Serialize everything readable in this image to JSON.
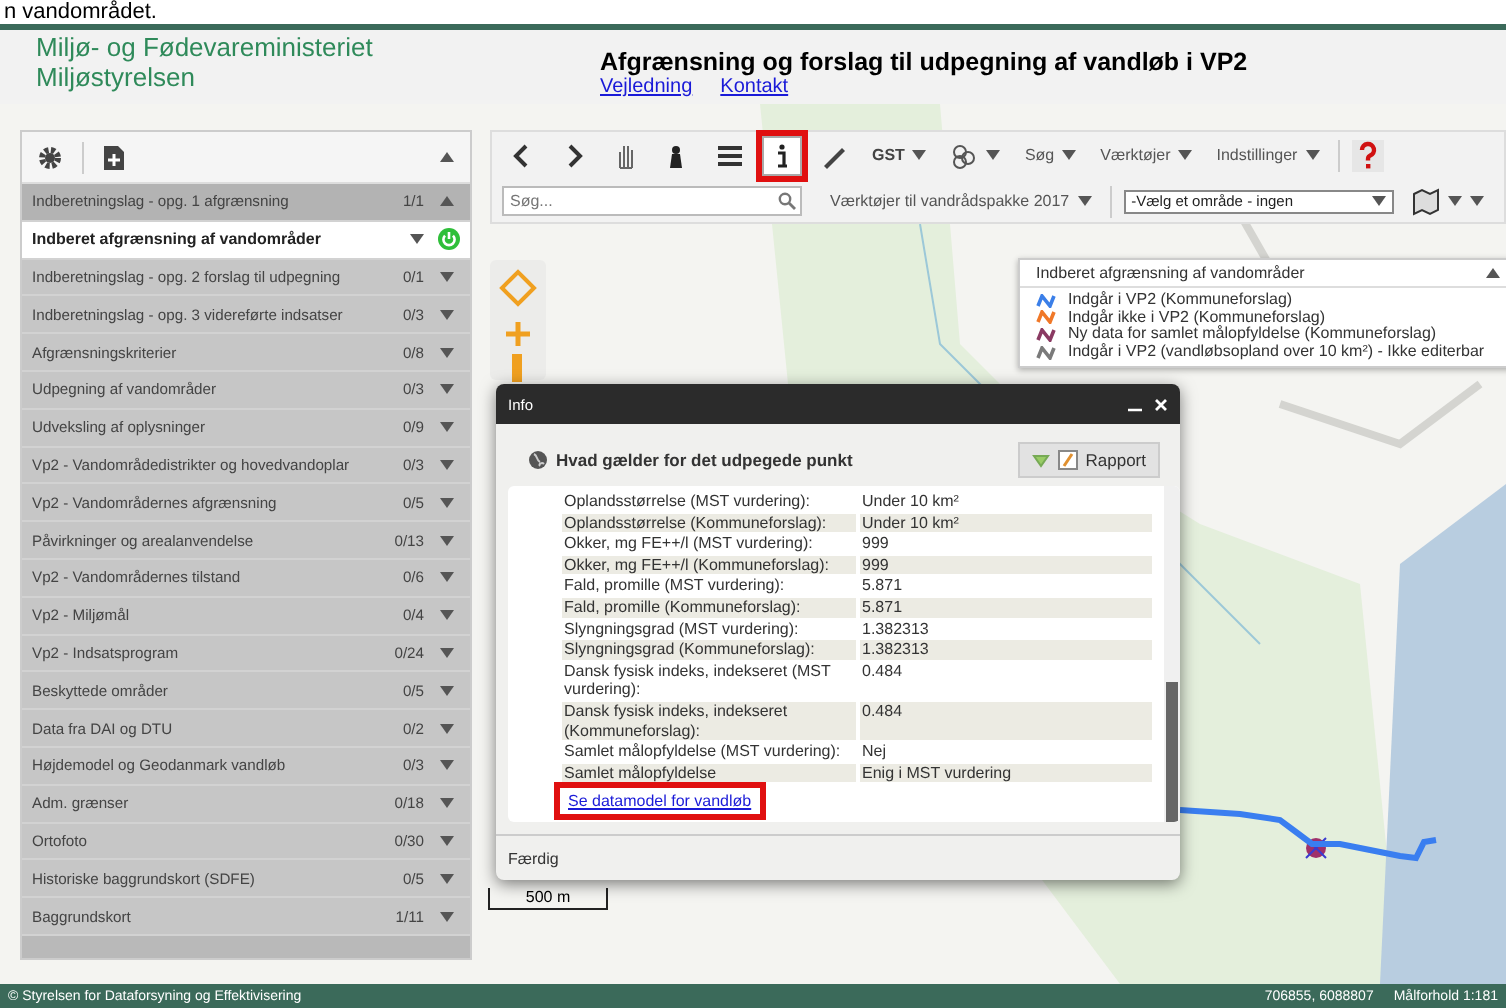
{
  "caption_fragment": "n vandområdet.",
  "header": {
    "ministry": "Miljø- og Fødevareministeriet",
    "agency": "Miljøstyrelsen",
    "title": "Afgrænsning og forslag til udpegning af vandløb i VP2",
    "links": [
      "Vejledning",
      "Kontakt"
    ]
  },
  "layer_panel": {
    "items": [
      {
        "kind": "group",
        "label": "Indberetningslag - opg. 1 afgrænsning",
        "count": "1/1",
        "expanded": true
      },
      {
        "kind": "layer",
        "label": "Indberet afgrænsning af vandområder",
        "visible": true
      },
      {
        "kind": "group",
        "label": "Indberetningslag - opg. 2 forslag til udpegning",
        "count": "0/1",
        "expanded": false
      },
      {
        "kind": "group",
        "label": "Indberetningslag - opg. 3 videreførte indsatser",
        "count": "0/3",
        "expanded": false
      },
      {
        "kind": "group",
        "label": "Afgrænsningskriterier",
        "count": "0/8",
        "expanded": false
      },
      {
        "kind": "group",
        "label": "Udpegning af vandområder",
        "count": "0/3",
        "expanded": false
      },
      {
        "kind": "group",
        "label": "Udveksling af oplysninger",
        "count": "0/9",
        "expanded": false
      },
      {
        "kind": "group",
        "label": "Vp2 - Vandområdedistrikter og hovedvandoplar",
        "count": "0/3",
        "expanded": false
      },
      {
        "kind": "group",
        "label": "Vp2 - Vandområdernes afgrænsning",
        "count": "0/5",
        "expanded": false
      },
      {
        "kind": "group",
        "label": "Påvirkninger og arealanvendelse",
        "count": "0/13",
        "expanded": false
      },
      {
        "kind": "group",
        "label": "Vp2 - Vandområdernes tilstand",
        "count": "0/6",
        "expanded": false
      },
      {
        "kind": "group",
        "label": "Vp2 - Miljømål",
        "count": "0/4",
        "expanded": false
      },
      {
        "kind": "group",
        "label": "Vp2 - Indsatsprogram",
        "count": "0/24",
        "expanded": false
      },
      {
        "kind": "group",
        "label": "Beskyttede områder",
        "count": "0/5",
        "expanded": false
      },
      {
        "kind": "group",
        "label": "Data fra DAI og DTU",
        "count": "0/2",
        "expanded": false
      },
      {
        "kind": "group",
        "label": "Højdemodel og Geodanmark vandløb",
        "count": "0/3",
        "expanded": false
      },
      {
        "kind": "group",
        "label": "Adm. grænser",
        "count": "0/18",
        "expanded": false
      },
      {
        "kind": "group",
        "label": "Ortofoto",
        "count": "0/30",
        "expanded": false
      },
      {
        "kind": "group",
        "label": "Historiske baggrundskort (SDFE)",
        "count": "0/5",
        "expanded": false
      },
      {
        "kind": "group",
        "label": "Baggrundskort",
        "count": "1/11",
        "expanded": false
      }
    ]
  },
  "map_toolbar": {
    "tools": [
      {
        "kind": "back",
        "selected": false,
        "highlighted": false
      },
      {
        "kind": "forward",
        "selected": false,
        "highlighted": false
      },
      {
        "kind": "pan",
        "selected": false,
        "highlighted": false
      },
      {
        "kind": "person",
        "selected": false,
        "highlighted": false
      },
      {
        "kind": "list",
        "selected": false,
        "highlighted": false
      },
      {
        "kind": "info",
        "selected": true,
        "highlighted": true
      },
      {
        "kind": "draw",
        "selected": false,
        "highlighted": false
      }
    ],
    "menus": [
      {
        "kind": "text",
        "label": "GST"
      },
      {
        "kind": "layers"
      },
      {
        "kind": "text",
        "label": "Søg"
      },
      {
        "kind": "text",
        "label": "Værktøjer"
      },
      {
        "kind": "text",
        "label": "Indstillinger"
      }
    ],
    "search": {
      "placeholder": "Søg..."
    },
    "package_menu": "Værktøjer til vandrådspakke 2017",
    "area_select": "-Vælg et område - ingen"
  },
  "legend": {
    "title": "Indberet afgrænsning af vandområder",
    "items": [
      {
        "label": "Indgår i VP2 (Kommuneforslag)",
        "color": "#3b7fe8"
      },
      {
        "label": "Indgår ikke i VP2 (Kommuneforslag)",
        "color": "#f07828"
      },
      {
        "label": "Ny data for samlet målopfyldelse (Kommuneforslag)",
        "color": "#8a3a62"
      },
      {
        "label": "Indgår i VP2 (vandløbsopland over 10 km²) - Ikke editerbar",
        "color": "#7a7a7a"
      }
    ]
  },
  "info_dialog": {
    "title": "Info",
    "heading": "Hvad gælder for det udpegede punkt",
    "report_button": "Rapport",
    "rows": [
      {
        "label": "Oplandsstørrelse (MST vurdering):",
        "value": "Under 10 km²"
      },
      {
        "label": "Oplandsstørrelse (Kommuneforslag):",
        "value": "Under 10 km²"
      },
      {
        "label": "Okker, mg FE++/l (MST vurdering):",
        "value": "999"
      },
      {
        "label": "Okker, mg FE++/l (Kommuneforslag):",
        "value": "999"
      },
      {
        "label": "Fald, promille (MST vurdering):",
        "value": "5.871"
      },
      {
        "label": "Fald, promille (Kommuneforslag):",
        "value": "5.871"
      },
      {
        "label": "Slyngningsgrad (MST vurdering):",
        "value": "1.382313"
      },
      {
        "label": "Slyngningsgrad (Kommuneforslag):",
        "value": "1.382313"
      },
      {
        "label": "Dansk fysisk indeks, indekseret (MST vurdering):",
        "value": "0.484"
      },
      {
        "label": "Dansk fysisk indeks, indekseret (Kommuneforslag):",
        "value": "0.484"
      },
      {
        "label": "Samlet målopfyldelse (MST vurdering):",
        "value": "Nej"
      },
      {
        "label": "Samlet målopfyldelse",
        "value": "Enig i MST vurdering"
      }
    ],
    "link": {
      "label": "Se datamodel for vandløb",
      "highlighted": true
    },
    "status": "Færdig"
  },
  "scale": "500 m",
  "status_bar": {
    "copyright": "© Styrelsen for Dataforsyning og Effektivisering",
    "coordinates": "706855, 6088807",
    "scale": "Målforhold 1:181"
  }
}
